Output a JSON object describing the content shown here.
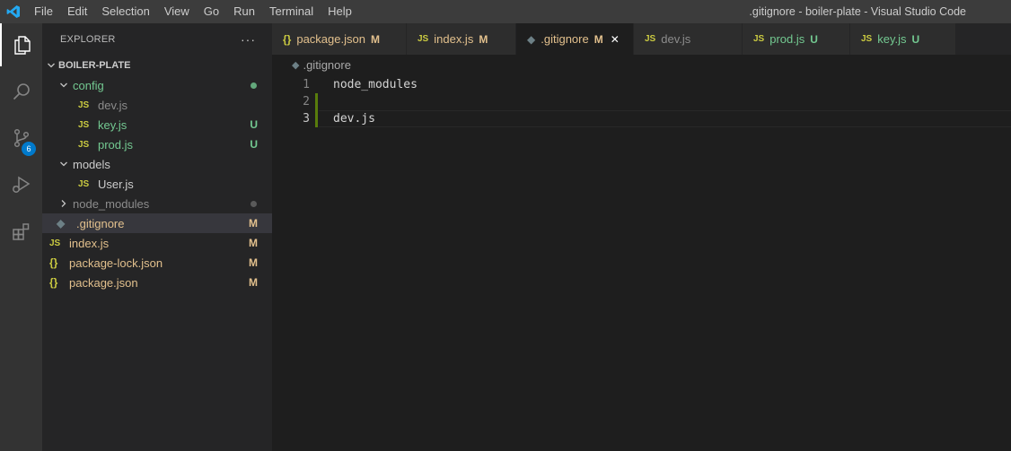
{
  "titlebar": {
    "menu": [
      "File",
      "Edit",
      "Selection",
      "View",
      "Go",
      "Run",
      "Terminal",
      "Help"
    ],
    "window_title": ".gitignore - boiler-plate - Visual Studio Code"
  },
  "activity": {
    "scm_badge": "6"
  },
  "sidebar": {
    "title": "EXPLORER",
    "more": "···",
    "project": "BOILER-PLATE",
    "tree": [
      {
        "label": "config",
        "kind": "folder",
        "level": 1,
        "color": "green",
        "status": "dot"
      },
      {
        "label": "dev.js",
        "kind": "js",
        "level": 2,
        "color": "dim",
        "status": ""
      },
      {
        "label": "key.js",
        "kind": "js",
        "level": 2,
        "color": "green",
        "status": "U"
      },
      {
        "label": "prod.js",
        "kind": "js",
        "level": 2,
        "color": "green",
        "status": "U"
      },
      {
        "label": "models",
        "kind": "folder",
        "level": 1,
        "color": "norm",
        "status": ""
      },
      {
        "label": "User.js",
        "kind": "js",
        "level": 2,
        "color": "norm",
        "status": ""
      },
      {
        "label": "node_modules",
        "kind": "folder-collapsed",
        "level": 1,
        "color": "dim",
        "status": "dot-dim"
      },
      {
        "label": ".gitignore",
        "kind": "git",
        "level": 1,
        "color": "mod",
        "status": "M",
        "selected": true
      },
      {
        "label": "index.js",
        "kind": "js",
        "level": 0,
        "color": "mod",
        "status": "M"
      },
      {
        "label": "package-lock.json",
        "kind": "json",
        "level": 0,
        "color": "mod",
        "status": "M"
      },
      {
        "label": "package.json",
        "kind": "json",
        "level": 0,
        "color": "mod",
        "status": "M"
      }
    ]
  },
  "tabs": [
    {
      "label": "package.json",
      "kind": "json",
      "status": "M",
      "color": "mod",
      "width": 150
    },
    {
      "label": "index.js",
      "kind": "js",
      "status": "M",
      "color": "mod",
      "width": 122
    },
    {
      "label": ".gitignore",
      "kind": "git",
      "status": "M",
      "color": "mod",
      "width": 131,
      "active": true
    },
    {
      "label": "dev.js",
      "kind": "js",
      "status": "",
      "color": "dim",
      "width": 121
    },
    {
      "label": "prod.js",
      "kind": "js",
      "status": "U",
      "color": "green",
      "width": 120
    },
    {
      "label": "key.js",
      "kind": "js",
      "status": "U",
      "color": "green",
      "width": 118
    }
  ],
  "icons": {
    "js": "JS",
    "json": "{}",
    "git": "◆"
  },
  "breadcrumb": ".gitignore",
  "editor": {
    "lines": [
      {
        "num": "1",
        "text": "node_modules"
      },
      {
        "num": "2",
        "text": ""
      },
      {
        "num": "3",
        "text": "dev.js"
      }
    ]
  },
  "colors": {
    "accent": "#007acc",
    "modified": "#e2c08d",
    "untracked": "#73c991",
    "added_gutter": "#587c0c"
  }
}
